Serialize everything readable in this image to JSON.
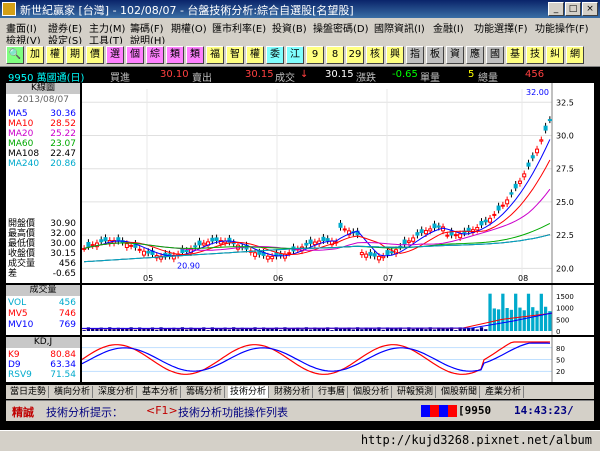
{
  "window": {
    "title": "新世紀贏家 [台灣] - 102/08/07 - 台盤技術分析:綜合自選股[名望股]",
    "buttons": [
      "_",
      "□",
      "×"
    ]
  },
  "menu": {
    "row1": [
      "畫面(I)",
      "證券(E)",
      "主力(M)",
      "籌碼(F)",
      "期權(O)",
      "匯市利率(E)",
      "投資(B)",
      "操盤密碼(D)",
      "國際資訊(I)",
      "金融(I)",
      "功能選擇(F)",
      "功能操作(F)"
    ],
    "row2": [
      "檢視(V)",
      "設定(S)",
      "工具(T)",
      "說明(H)"
    ]
  },
  "toolbar": {
    "buttons": [
      "🔍",
      "加",
      "權",
      "期",
      "價",
      "選",
      "個",
      "綜",
      "類",
      "類",
      "福",
      "智",
      "權",
      "委",
      "江",
      "9",
      "8",
      "29",
      "核",
      "興",
      "指",
      "板",
      "資",
      "應",
      "國",
      "基",
      "技",
      "糾",
      "網"
    ]
  },
  "quote": {
    "code_name": "9950 萬國通(日)",
    "bid_label": "買進",
    "bid": "30.10",
    "ask_label": "賣出",
    "ask": "30.15",
    "last_label": "成交",
    "last_arrow": "↓",
    "last": "30.15",
    "change_label": "漲跌",
    "change": "-0.65",
    "vol_label": "單量",
    "vol": "5",
    "total_label": "總量",
    "total": "456"
  },
  "kpanel": {
    "header": "K線圖",
    "date": "2013/08/07",
    "mas": [
      {
        "label": "MA5",
        "value": "30.36",
        "color": "#0000ff"
      },
      {
        "label": "MA10",
        "value": "28.52",
        "color": "#ff0000"
      },
      {
        "label": "MA20",
        "value": "25.22",
        "color": "#cc00cc"
      },
      {
        "label": "MA60",
        "value": "23.07",
        "color": "#00aa00"
      },
      {
        "label": "MA108",
        "value": "22.47",
        "color": "#000000"
      },
      {
        "label": "MA240",
        "value": "20.86",
        "color": "#00aacc"
      }
    ],
    "prices": [
      {
        "label": "開盤價",
        "value": "30.90"
      },
      {
        "label": "最高價",
        "value": "32.00"
      },
      {
        "label": "最低價",
        "value": "30.00"
      },
      {
        "label": "收盤價",
        "value": "30.15"
      },
      {
        "label": "成交量",
        "value": "456"
      },
      {
        "label": "差",
        "value": "-0.65"
      }
    ]
  },
  "volpanel": {
    "header": "成交量",
    "rows": [
      {
        "label": "VOL",
        "value": "456",
        "color": "#00aacc"
      },
      {
        "label": "MV5",
        "value": "746",
        "color": "#ff0000"
      },
      {
        "label": "MV10",
        "value": "769",
        "color": "#0000ff"
      }
    ]
  },
  "kdpanel": {
    "header": "KD,J",
    "rows": [
      {
        "label": "K9",
        "value": "80.84",
        "color": "#ff0000"
      },
      {
        "label": "D9",
        "value": "63.34",
        "color": "#0000ff"
      },
      {
        "label": "RSV9",
        "value": "71.54",
        "color": "#00aacc"
      }
    ]
  },
  "chart_data": [
    {
      "type": "candlestick",
      "x_ticks": [
        "05",
        "06",
        "07",
        "08"
      ],
      "y_ticks": [
        "32.5",
        "30.0",
        "27.5",
        "25.0",
        "22.5",
        "20.0"
      ],
      "ylim": [
        19.5,
        33.5
      ],
      "annotations": [
        "32.00",
        "20.90"
      ]
    },
    {
      "type": "bar",
      "y_ticks": [
        "1500",
        "1000",
        "500",
        "0"
      ],
      "ylim": [
        0,
        1800
      ]
    },
    {
      "type": "line",
      "y_ticks": [
        "80",
        "50",
        "20"
      ],
      "ylim": [
        0,
        100
      ]
    }
  ],
  "tabs": [
    "當日走勢",
    "橫向分析",
    "深度分析",
    "基本分析",
    "籌碼分析",
    "技術分析",
    "財務分析",
    "行事曆",
    "個股分析",
    "研報預測",
    "個股新聞",
    "產業分析"
  ],
  "status": {
    "brand": "精誠",
    "hint": "技術分析提示：",
    "key": "<F1>",
    "hint2": "技術分析功能操作列表",
    "code": "[9950",
    "time": "14:43:23/"
  },
  "footer": {
    "url": "http://kujd3268.pixnet.net/album"
  }
}
